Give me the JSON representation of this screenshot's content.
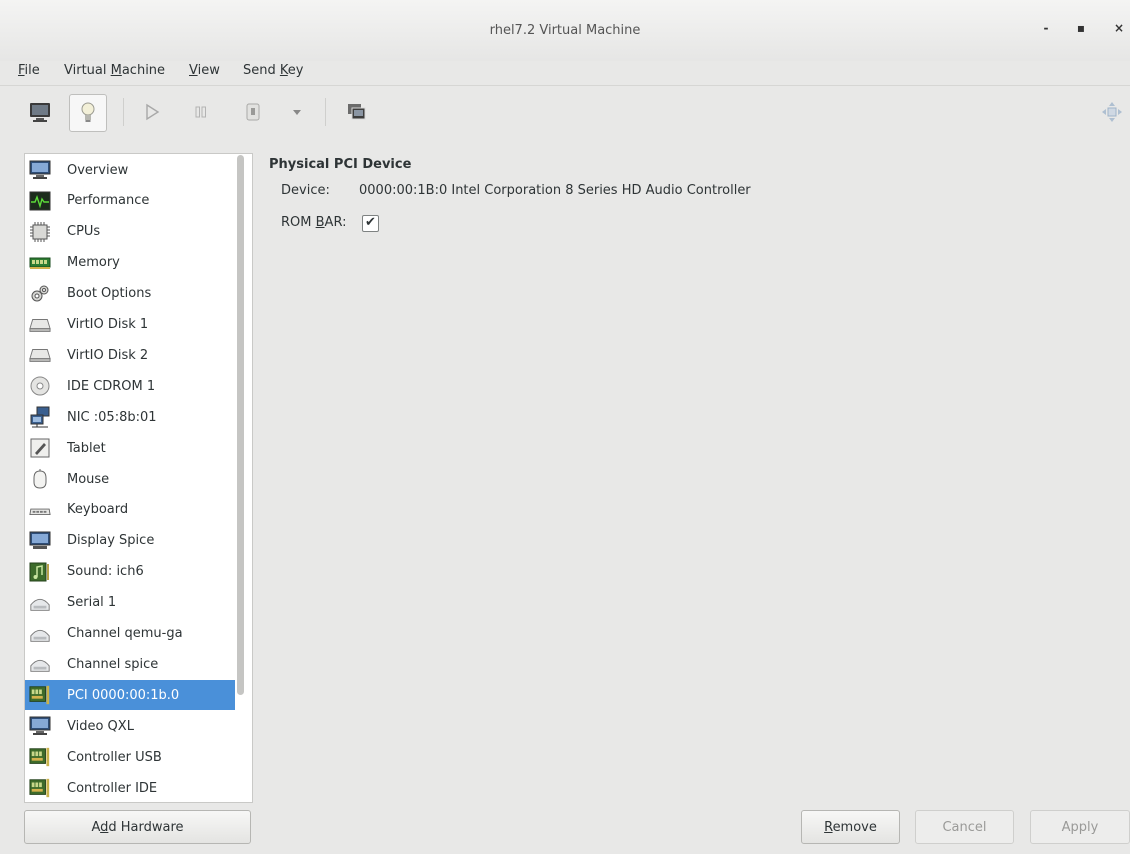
{
  "window": {
    "title": "rhel7.2 Virtual Machine",
    "minimize": "-",
    "maximize": "▪",
    "close": "×"
  },
  "menu": {
    "file": {
      "mnemonic": "F",
      "rest": "ile"
    },
    "vm": {
      "pre": "Virtual ",
      "mnemonic": "M",
      "rest": "achine"
    },
    "view": {
      "mnemonic": "V",
      "rest": "iew"
    },
    "sendkey": {
      "pre": "Send ",
      "mnemonic": "K",
      "rest": "ey"
    }
  },
  "toolbar": {
    "items": [
      {
        "name": "console-icon"
      },
      {
        "name": "details-lightbulb-icon",
        "active": true
      },
      {
        "name": "run-icon"
      },
      {
        "name": "pause-icon"
      },
      {
        "name": "shutdown-icon"
      },
      {
        "name": "shutdown-menu-icon"
      },
      {
        "name": "snapshot-icon"
      },
      {
        "name": "resize-icon"
      }
    ]
  },
  "sidebar": {
    "items": [
      {
        "label": "Overview",
        "icon": "monitor-icon"
      },
      {
        "label": "Performance",
        "icon": "performance-icon"
      },
      {
        "label": "CPUs",
        "icon": "cpu-icon"
      },
      {
        "label": "Memory",
        "icon": "memory-icon"
      },
      {
        "label": "Boot Options",
        "icon": "gears-icon"
      },
      {
        "label": "VirtIO Disk 1",
        "icon": "disk-icon"
      },
      {
        "label": "VirtIO Disk 2",
        "icon": "disk-icon"
      },
      {
        "label": "IDE CDROM 1",
        "icon": "cdrom-icon"
      },
      {
        "label": "NIC :05:8b:01",
        "icon": "network-icon"
      },
      {
        "label": "Tablet",
        "icon": "tablet-icon"
      },
      {
        "label": "Mouse",
        "icon": "mouse-icon"
      },
      {
        "label": "Keyboard",
        "icon": "keyboard-icon"
      },
      {
        "label": "Display Spice",
        "icon": "display-icon"
      },
      {
        "label": "Sound: ich6",
        "icon": "sound-icon"
      },
      {
        "label": "Serial 1",
        "icon": "serial-icon"
      },
      {
        "label": "Channel qemu-ga",
        "icon": "channel-icon"
      },
      {
        "label": "Channel spice",
        "icon": "channel-icon"
      },
      {
        "label": "PCI 0000:00:1b.0",
        "icon": "pci-card-icon",
        "selected": true
      },
      {
        "label": "Video QXL",
        "icon": "video-icon"
      },
      {
        "label": "Controller USB",
        "icon": "controller-icon"
      },
      {
        "label": "Controller IDE",
        "icon": "controller-icon"
      }
    ]
  },
  "details": {
    "title": "Physical PCI Device",
    "device_label": "Device:",
    "device_value": "0000:00:1B:0 Intel Corporation 8 Series HD Audio Controller",
    "rombar_pre": "ROM ",
    "rombar_mnemonic": "B",
    "rombar_rest": "AR:",
    "rombar_checked": "✔"
  },
  "buttons": {
    "add_hw_pre": "A",
    "add_hw_mnemonic": "d",
    "add_hw_rest": "d Hardware",
    "remove_mnemonic": "R",
    "remove_rest": "emove",
    "cancel": "Cancel",
    "apply": "Apply"
  },
  "colors": {
    "selection": "#4a90d9",
    "window_bg": "#e8e8e7"
  }
}
